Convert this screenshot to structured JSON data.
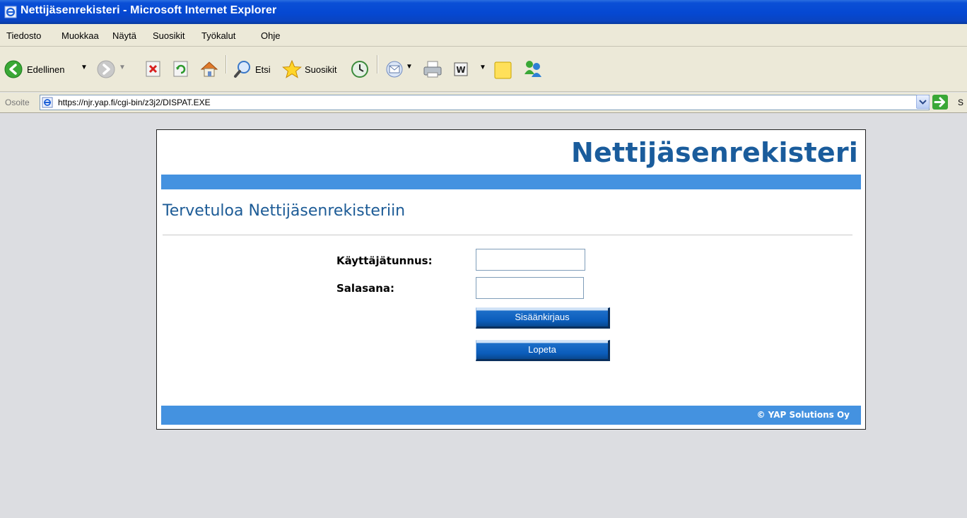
{
  "window": {
    "title": "Nettijäsenrekisteri - Microsoft Internet Explorer"
  },
  "menu": {
    "items": [
      "Tiedosto",
      "Muokkaa",
      "Näytä",
      "Suosikit",
      "Työkalut",
      "Ohje"
    ]
  },
  "toolbar": {
    "back_label": "Edellinen",
    "search_label": "Etsi",
    "favorites_label": "Suosikit"
  },
  "address": {
    "label": "Osoite",
    "url": "https://njr.yap.fi/cgi-bin/z3j2/DISPAT.EXE",
    "go_label": "S"
  },
  "page": {
    "brand": "Nettijäsenrekisteri",
    "welcome": "Tervetuloa Nettijäsenrekisteriin",
    "username_label": "Käyttäjätunnus:",
    "username_value": "",
    "password_label": "Salasana:",
    "password_value": "",
    "login_button": "Sisäänkirjaus",
    "quit_button": "Lopeta",
    "copyright": "© YAP Solutions Oy"
  },
  "colors": {
    "title_bar": "#0548d2",
    "brand_text": "#1a5c9c",
    "band": "#4492e0",
    "button": "#0b5cba"
  }
}
